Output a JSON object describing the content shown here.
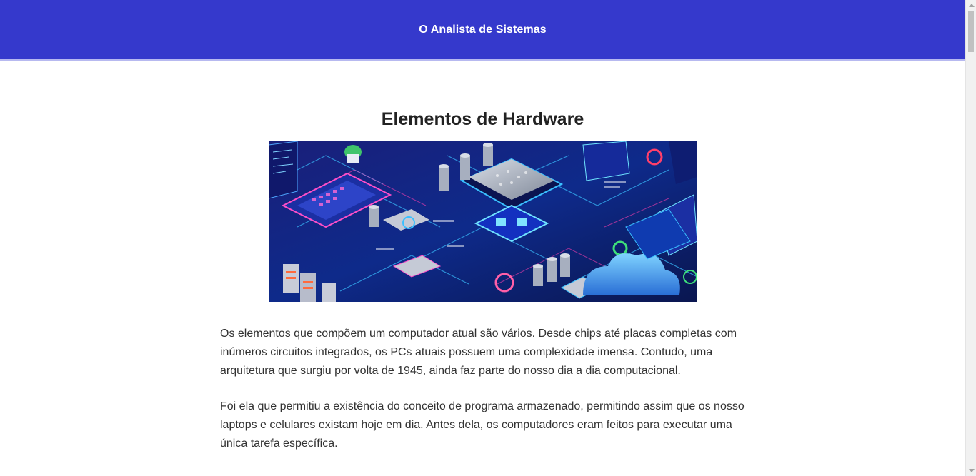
{
  "header": {
    "site_title": "O Analista de Sistemas"
  },
  "article": {
    "title": "Elementos de Hardware",
    "hero_image": "circuit-board-illustration",
    "paragraphs": [
      "Os elementos que compõem um computador atual são vários. Desde chips até placas completas com inúmeros circuitos integrados, os PCs atuais possuem uma complexidade imensa. Contudo, uma arquitetura que surgiu por volta de 1945, ainda faz parte do nosso dia a dia computacional.",
      "Foi ela que permitiu a existência do conceito de programa armazenado, permitindo assim que os nosso laptops e celulares existam hoje em dia. Antes dela, os computadores eram feitos para executar uma única tarefa específica."
    ]
  },
  "colors": {
    "header_bg": "#3539cc",
    "header_text": "#ffffff",
    "title_text": "#222222",
    "body_text": "#333333"
  },
  "scrollbar": {
    "up_icon": "triangle-up-icon",
    "down_icon": "triangle-down-icon"
  }
}
